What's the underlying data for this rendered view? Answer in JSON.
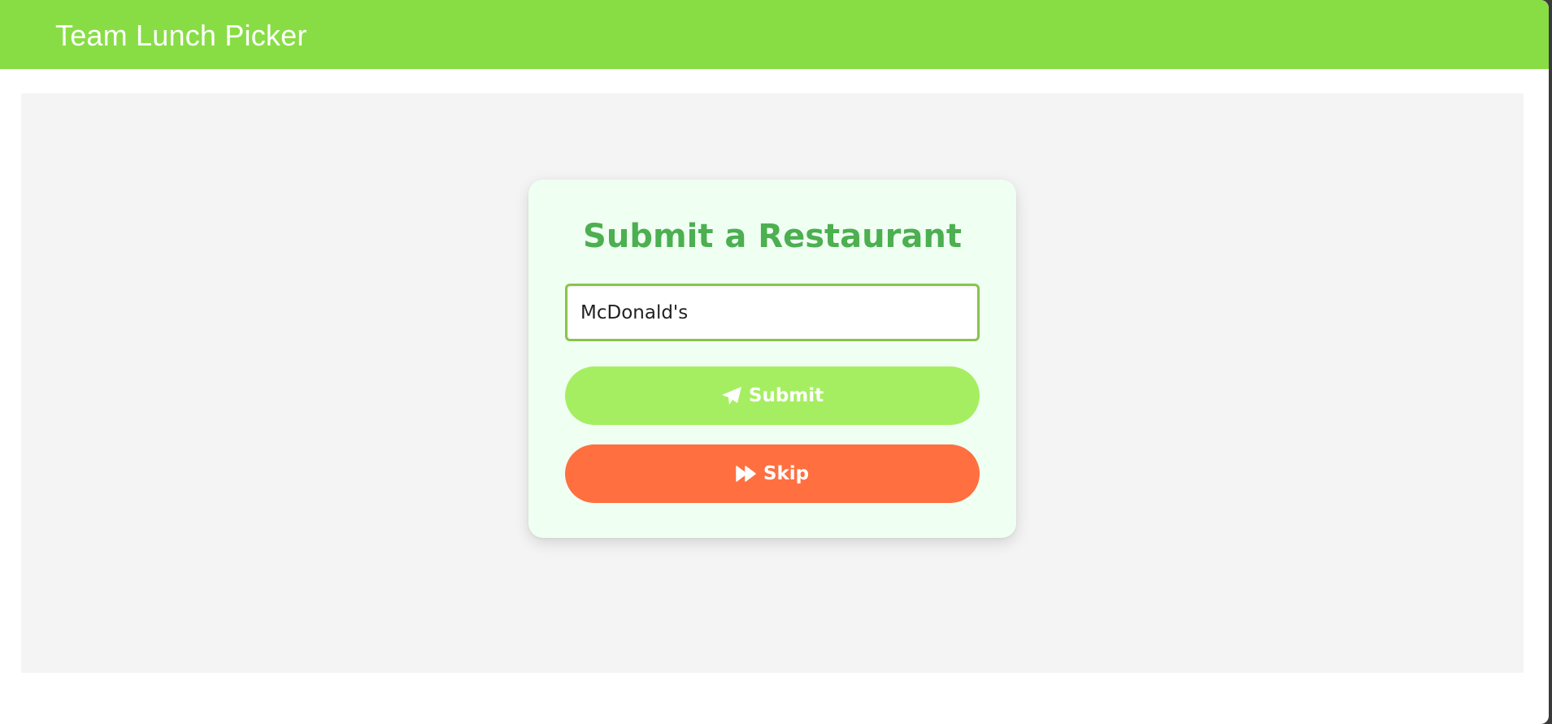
{
  "header": {
    "title": "Team Lunch Picker"
  },
  "form": {
    "title": "Submit a Restaurant",
    "restaurant_input_value": "McDonald's",
    "submit_label": "Submit",
    "submit_icon": "paper-plane-icon",
    "skip_label": "Skip",
    "skip_icon": "fast-forward-icon"
  },
  "colors": {
    "header": "#88dd44",
    "title": "#4caf50",
    "card_background": "#effff2",
    "submit_button": "#a6ee61",
    "skip_button": "#ff6f40",
    "input_border": "#8bc34a"
  }
}
